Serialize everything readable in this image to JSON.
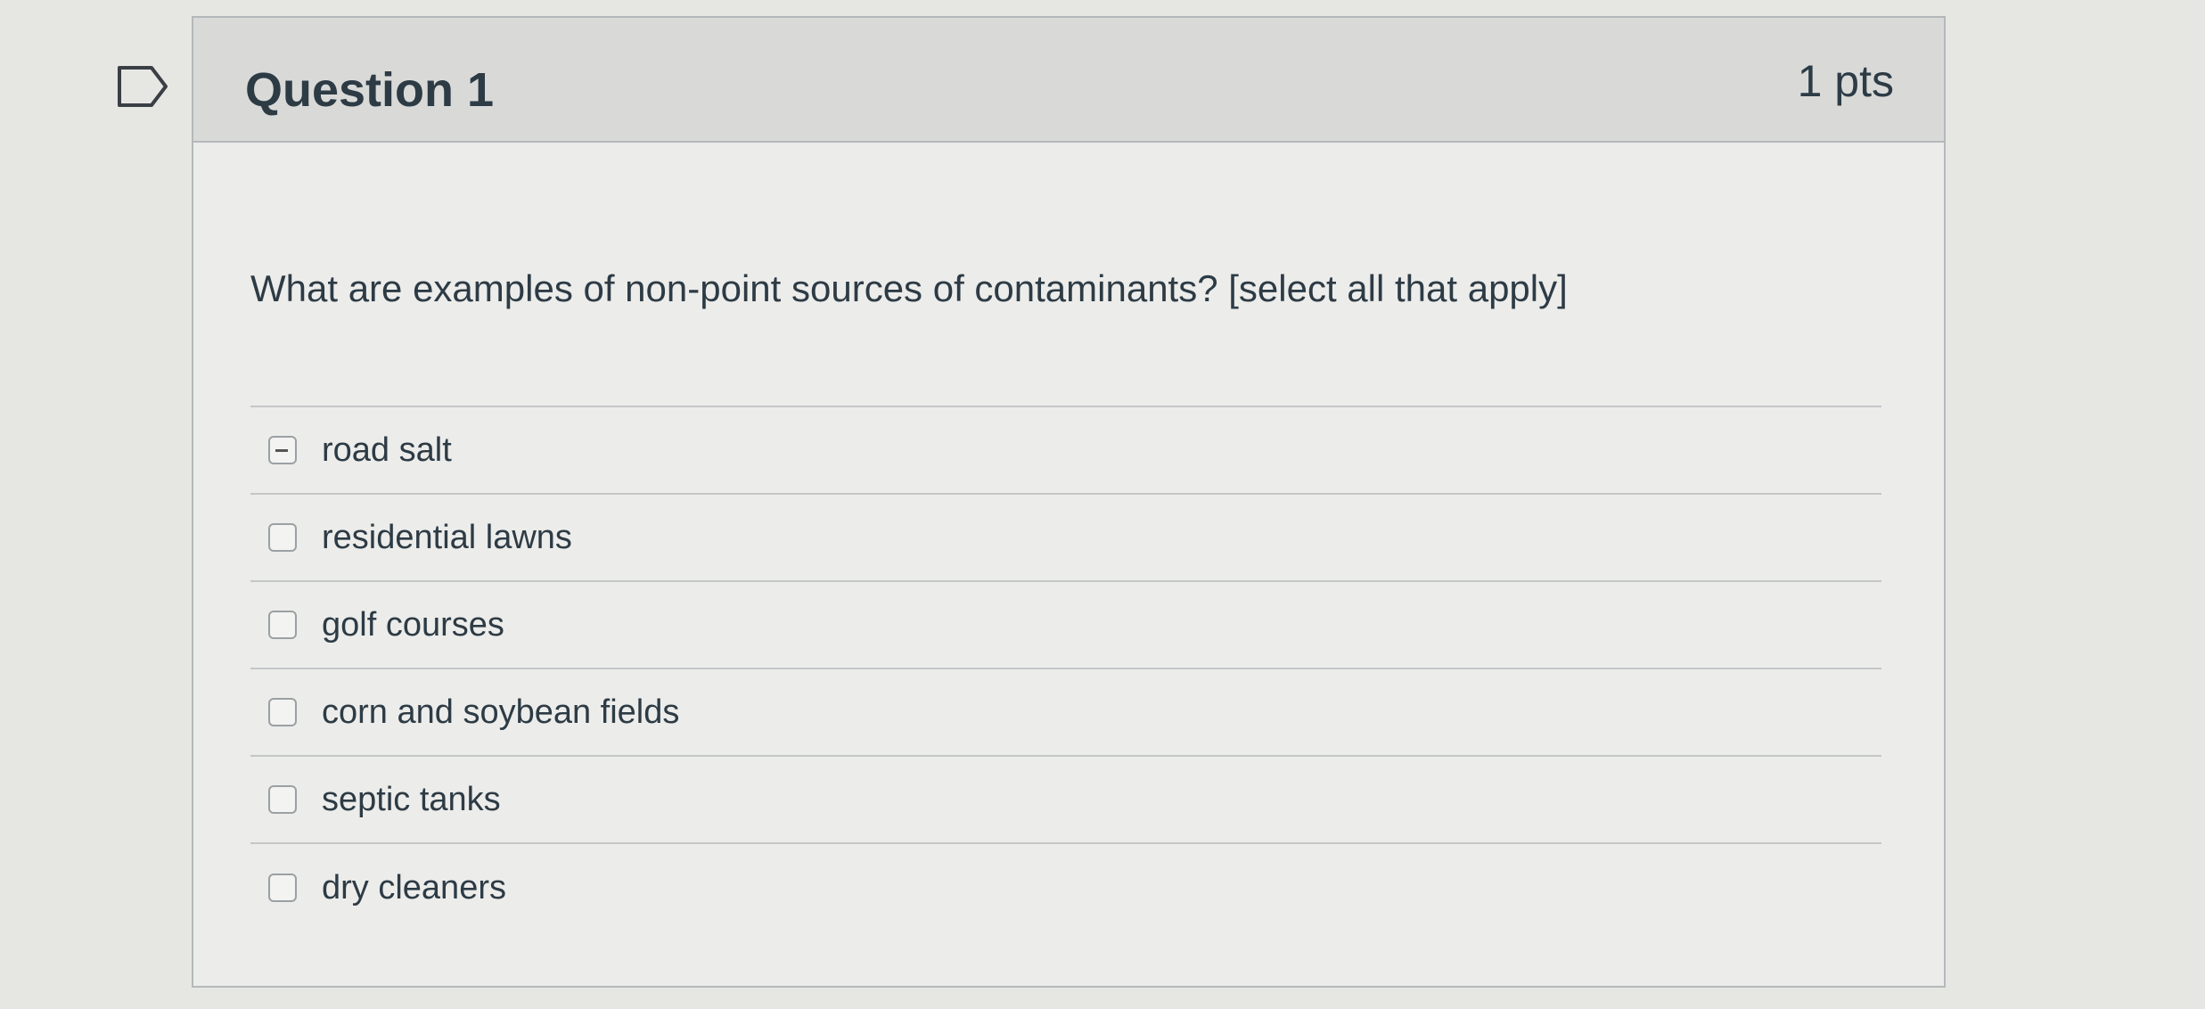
{
  "question": {
    "title": "Question 1",
    "points": "1 pts",
    "text": "What are examples of non-point sources of contaminants? [select all that apply]",
    "answers": [
      {
        "label": "road salt",
        "marked": true
      },
      {
        "label": "residential lawns",
        "marked": false
      },
      {
        "label": "golf courses",
        "marked": false
      },
      {
        "label": "corn and soybean fields",
        "marked": false
      },
      {
        "label": "septic tanks",
        "marked": false
      },
      {
        "label": "dry cleaners",
        "marked": false
      }
    ]
  },
  "icons": {
    "flag": "flag-outline-icon",
    "checkbox": "checkbox-icon"
  },
  "colors": {
    "text": "#2d3b45",
    "header_bg": "#d9dad8",
    "border": "#b4b8ba"
  }
}
